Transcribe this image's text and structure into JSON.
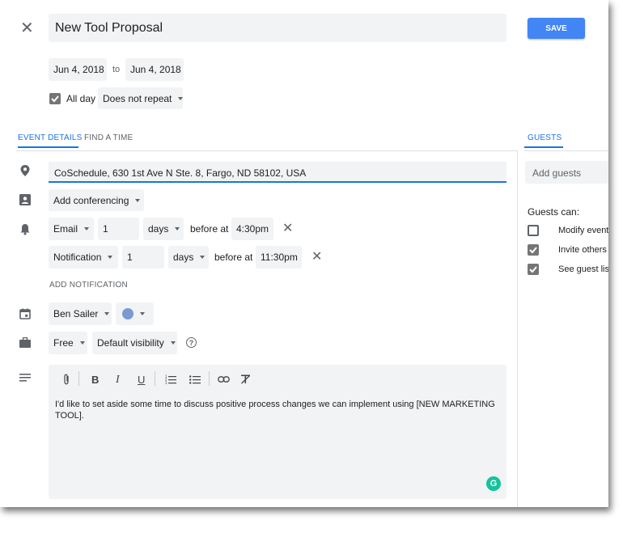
{
  "title": "New Tool Proposal",
  "save_label": "SAVE",
  "dates": {
    "start": "Jun 4, 2018",
    "sep": "to",
    "end": "Jun 4, 2018"
  },
  "allday": {
    "label": "All day",
    "checked": true
  },
  "repeat": "Does not repeat",
  "tabs": {
    "event_details": "EVENT DETAILS",
    "find_time": "FIND A TIME",
    "guests": "GUESTS"
  },
  "location": "CoSchedule, 630 1st Ave N Ste. 8, Fargo, ND 58102, USA",
  "conferencing": "Add conferencing",
  "notifications": [
    {
      "type": "Email",
      "amount": "1",
      "unit": "days",
      "before": "before at",
      "time": "4:30pm"
    },
    {
      "type": "Notification",
      "amount": "1",
      "unit": "days",
      "before": "before at",
      "time": "11:30pm"
    }
  ],
  "add_notification": "ADD NOTIFICATION",
  "calendar": {
    "owner": "Ben Sailer",
    "color": "#7b9ad3"
  },
  "availability": "Free",
  "visibility": "Default visibility",
  "description": "I'd like to set aside some time to discuss positive process changes we can implement using [NEW MARKETING TOOL].",
  "guests": {
    "add_placeholder": "Add guests",
    "can_label": "Guests can:",
    "permissions": [
      {
        "label": "Modify event",
        "checked": false
      },
      {
        "label": "Invite others",
        "checked": true
      },
      {
        "label": "See guest list",
        "checked": true
      }
    ]
  },
  "colors": {
    "accent": "#1a73e8",
    "save_bg": "#4285f4"
  }
}
